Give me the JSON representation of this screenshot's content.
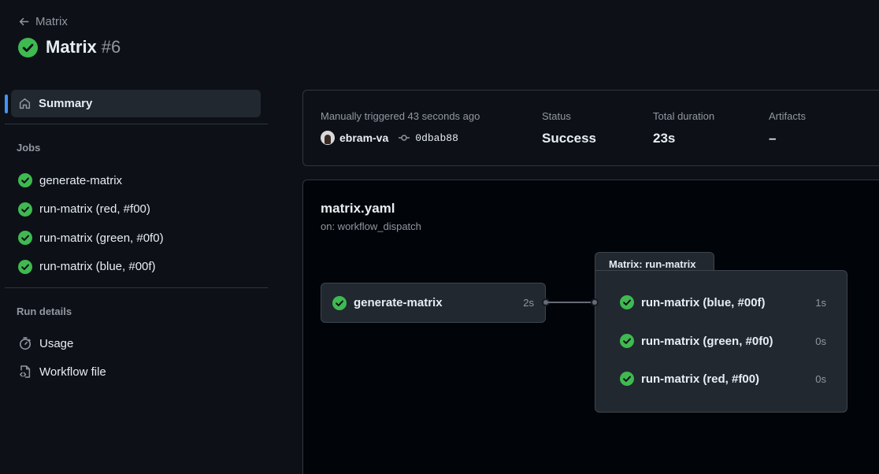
{
  "header": {
    "back_label": "Matrix",
    "title": "Matrix",
    "run_number": "#6"
  },
  "sidebar": {
    "summary_label": "Summary",
    "jobs_heading": "Jobs",
    "jobs": [
      {
        "label": "generate-matrix"
      },
      {
        "label": "run-matrix (red, #f00)"
      },
      {
        "label": "run-matrix (green, #0f0)"
      },
      {
        "label": "run-matrix (blue, #00f)"
      }
    ],
    "run_details_heading": "Run details",
    "usage_label": "Usage",
    "workflow_file_label": "Workflow file"
  },
  "summary": {
    "trigger_text": "Manually triggered 43 seconds ago",
    "actor": "ebram-va",
    "commit_sha": "0dbab88",
    "status_label": "Status",
    "status_value": "Success",
    "duration_label": "Total duration",
    "duration_value": "23s",
    "artifacts_label": "Artifacts",
    "artifacts_value": "–"
  },
  "graph": {
    "workflow_file": "matrix.yaml",
    "trigger": "on: workflow_dispatch",
    "job": {
      "name": "generate-matrix",
      "duration": "2s"
    },
    "matrix_title": "Matrix: run-matrix",
    "matrix_jobs": [
      {
        "name": "run-matrix (blue, #00f)",
        "duration": "1s"
      },
      {
        "name": "run-matrix (green, #0f0)",
        "duration": "0s"
      },
      {
        "name": "run-matrix (red, #f00)",
        "duration": "0s"
      }
    ]
  },
  "colors": {
    "background": "#0d1117",
    "success": "#3fb950",
    "accent": "#4493f8"
  },
  "icons": [
    "arrow-left-icon",
    "check-circle-fill-icon",
    "home-icon",
    "stopwatch-icon",
    "file-code-icon",
    "git-commit-icon"
  ]
}
